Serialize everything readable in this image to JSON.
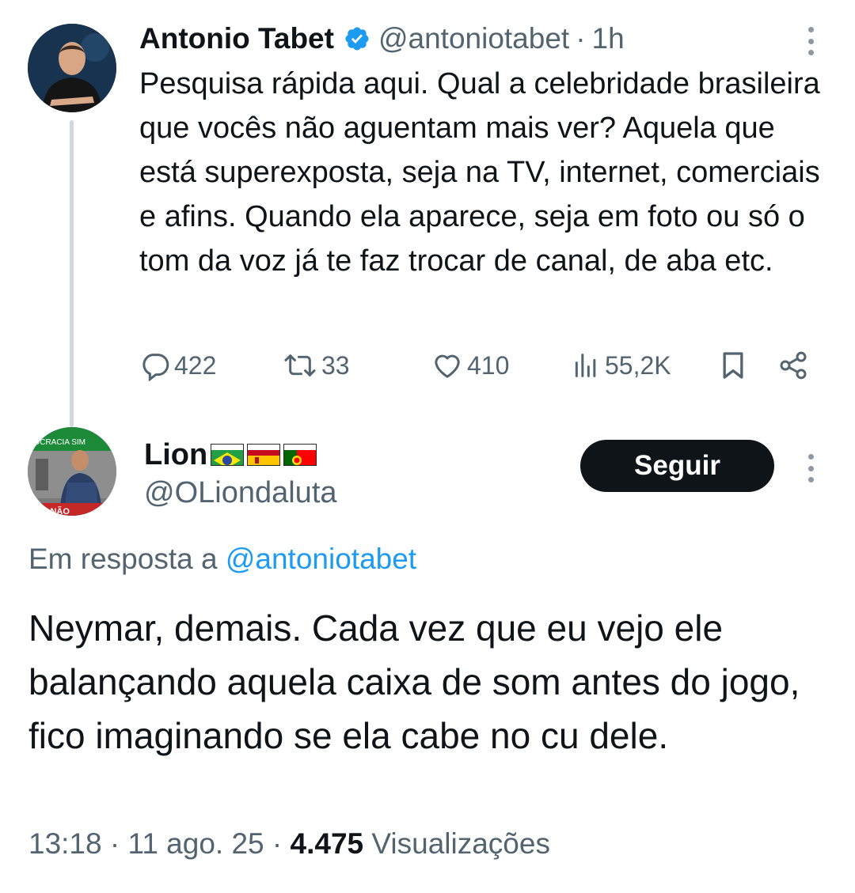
{
  "parent_tweet": {
    "author_name": "Antonio Tabet",
    "handle": "@antoniotabet",
    "separator": "·",
    "time": "1h",
    "text": "Pesquisa rápida aqui. Qual a celebridade brasileira que vocês não aguentam mais ver? Aquela que está superexposta, seja na TV, internet, comerciais e afins. Quando ela aparece, seja em foto ou só o tom da voz já te faz trocar de canal, de aba etc.",
    "actions": {
      "replies": "422",
      "reposts": "33",
      "likes": "410",
      "views": "55,2K"
    },
    "icons": [
      "verified-badge-icon",
      "more-icon",
      "reply-icon",
      "repost-icon",
      "like-icon",
      "views-icon",
      "bookmark-icon",
      "share-icon"
    ]
  },
  "reply_tweet": {
    "author_name": "Lion",
    "flags": [
      "brazil-flag-icon",
      "spain-flag-icon",
      "portugal-flag-icon"
    ],
    "handle": "@OLiondaluta",
    "follow_label": "Seguir",
    "reply_prefix": "Em resposta a",
    "reply_target": "@antoniotabet",
    "avatar_banner_top": "DCRACIA SIM",
    "avatar_banner_bottom": "LPE NÃO",
    "text": "Neymar, demais. Cada vez que eu vejo ele balançando aquela caixa de som antes do jogo, fico imaginando se ela cabe no cu dele.",
    "time": "13:18",
    "date": "11 ago. 25",
    "meta_separator": "·",
    "views_count": "4.475",
    "views_label": "Visualizações"
  },
  "colors": {
    "text": "#0f1419",
    "secondary": "#536471",
    "link": "#1d9bf0",
    "button_bg": "#0f1419",
    "thread_line": "#cfd9de"
  }
}
